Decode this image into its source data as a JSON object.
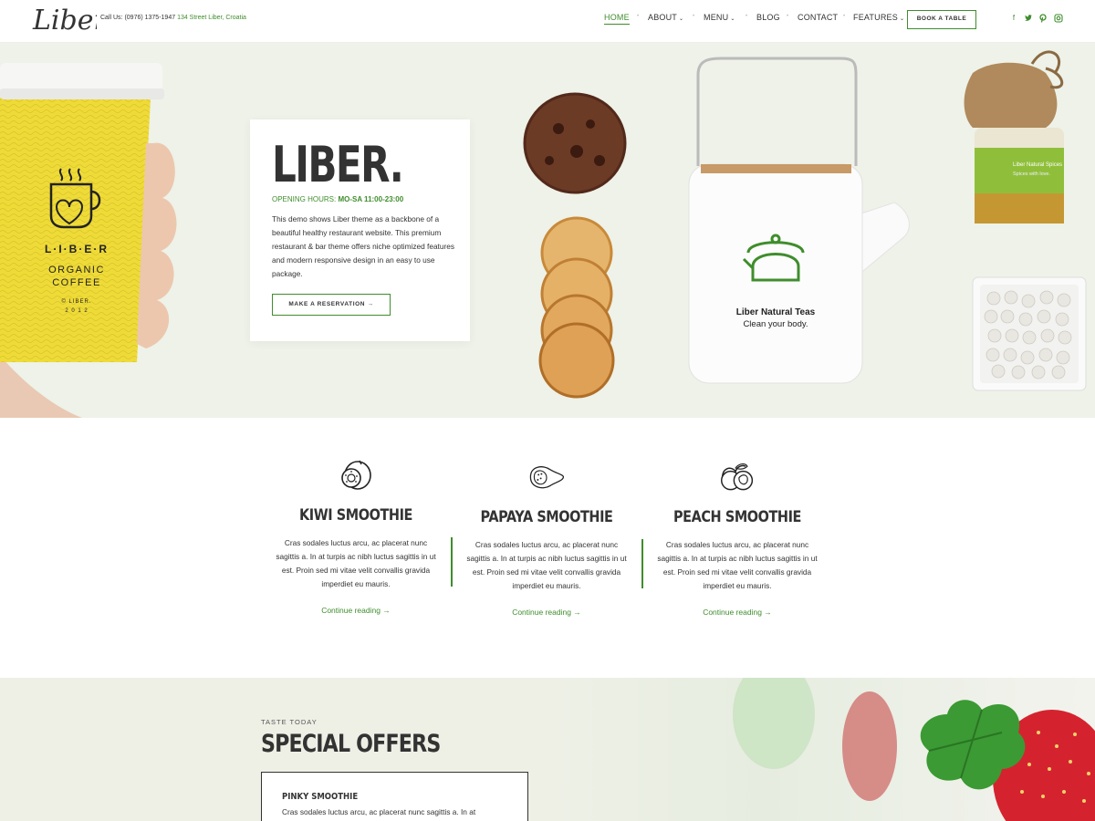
{
  "header": {
    "logo_text": "Liber.",
    "contact_phone": "Call Us: (0976) 1375-1947",
    "contact_address": "134 Street Liber, Croatia",
    "nav": [
      {
        "label": "HOME",
        "active": true
      },
      {
        "label": "ABOUT",
        "dropdown": true
      },
      {
        "label": "MENU",
        "dropdown": true
      },
      {
        "label": "BLOG"
      },
      {
        "label": "CONTACT"
      },
      {
        "label": "FEATURES",
        "dropdown": true
      }
    ],
    "book_label": "BOOK A TABLE",
    "social": [
      "facebook-icon",
      "twitter-icon",
      "pinterest-icon",
      "instagram-icon"
    ],
    "accent": "#3f8d2c"
  },
  "hero": {
    "cup_brand": "L·I·B·E·R",
    "cup_line1": "ORGANIC",
    "cup_line2": "COFFEE",
    "cup_line3": "© LIBER.",
    "cup_line4": "2 0 1 2",
    "title": "LIBER.",
    "hours_label": "OPENING HOURS:",
    "hours_value": "MO-SA 11:00-23:00",
    "text": "This demo shows Liber theme as a backbone of a beautiful healthy restaurant website. This premium restaurant & bar theme offers niche optimized features and modern responsive design in an easy to use package.",
    "button": "MAKE A RESERVATION →",
    "teapot_name": "Liber Natural Teas",
    "teapot_tagline": "Clean your body.",
    "jar_name": "Liber Natural Spices",
    "jar_tagline": "Spices with love."
  },
  "smoothies": [
    {
      "title": "KIWI SMOOTHIE",
      "icon": "kiwi-icon",
      "text": "Cras sodales luctus arcu, ac placerat nunc sagittis a. In at turpis ac nibh luctus sagittis in ut est. Proin sed mi vitae velit convallis gravida imperdiet eu mauris.",
      "link": "Continue reading →"
    },
    {
      "title": "PAPAYA SMOOTHIE",
      "icon": "papaya-icon",
      "text": "Cras sodales luctus arcu, ac placerat nunc sagittis a. In at turpis ac nibh luctus sagittis in ut est. Proin sed mi vitae velit convallis gravida imperdiet eu mauris.",
      "link": "Continue reading →"
    },
    {
      "title": "PEACH SMOOTHIE",
      "icon": "peach-icon",
      "text": "Cras sodales luctus arcu, ac placerat nunc sagittis a. In at turpis ac nibh luctus sagittis in ut est. Proin sed mi vitae velit convallis gravida imperdiet eu mauris.",
      "link": "Continue reading →"
    }
  ],
  "offers": {
    "kicker": "TASTE TODAY",
    "title": "SPECIAL OFFERS",
    "item_name": "PINKY SMOOTHIE",
    "item_desc": "Cras sodales luctus arcu, ac placerat nunc sagittis a. In at"
  }
}
